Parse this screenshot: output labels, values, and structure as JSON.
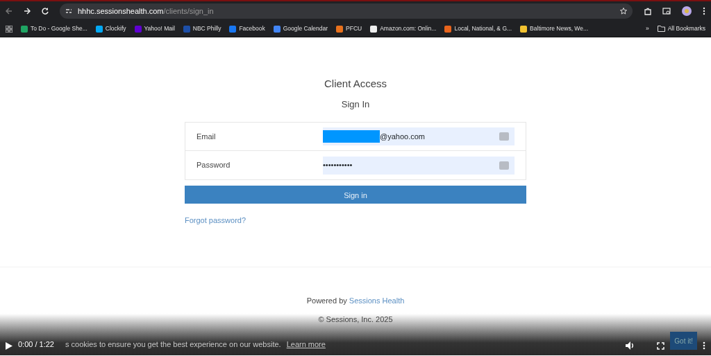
{
  "browser": {
    "url_host": "hhhc.sessionshealth.com",
    "url_path": "/clients/sign_in",
    "bookmarks": [
      {
        "label": "To Do - Google She...",
        "color": "#1fa463"
      },
      {
        "label": "Clockify",
        "color": "#03a9f4"
      },
      {
        "label": "Yahoo! Mail",
        "color": "#6001d2"
      },
      {
        "label": "NBC Philly",
        "color": "#1d4fa8"
      },
      {
        "label": "Facebook",
        "color": "#1877f2"
      },
      {
        "label": "Google Calendar",
        "color": "#4285f4"
      },
      {
        "label": "PFCU",
        "color": "#e8711c"
      },
      {
        "label": "Amazon.com: Onlin...",
        "color": "#eeeeee"
      },
      {
        "label": "Local, National, & G...",
        "color": "#e8641c"
      },
      {
        "label": "Baltimore News, We...",
        "color": "#f2c230"
      }
    ],
    "overflow": "»",
    "all_bookmarks": "All Bookmarks"
  },
  "page": {
    "heading": "Client Access",
    "subheading": "Sign In",
    "fields": [
      {
        "label": "Email",
        "value": "@yahoo.com",
        "redacted": true
      },
      {
        "label": "Password",
        "value": "•••••••••••",
        "redacted": false
      }
    ],
    "submit": "Sign in",
    "forgot": "Forgot password?",
    "footer": {
      "powered_prefix": "Powered by",
      "powered_link": "Sessions Health",
      "copyright": "© Sessions, Inc. 2025"
    },
    "cookie": {
      "text": "s cookies to ensure you get the best experience on our website.",
      "link": "Learn more",
      "button": "Got it!"
    }
  },
  "player": {
    "time": "0:00 / 1:22"
  }
}
